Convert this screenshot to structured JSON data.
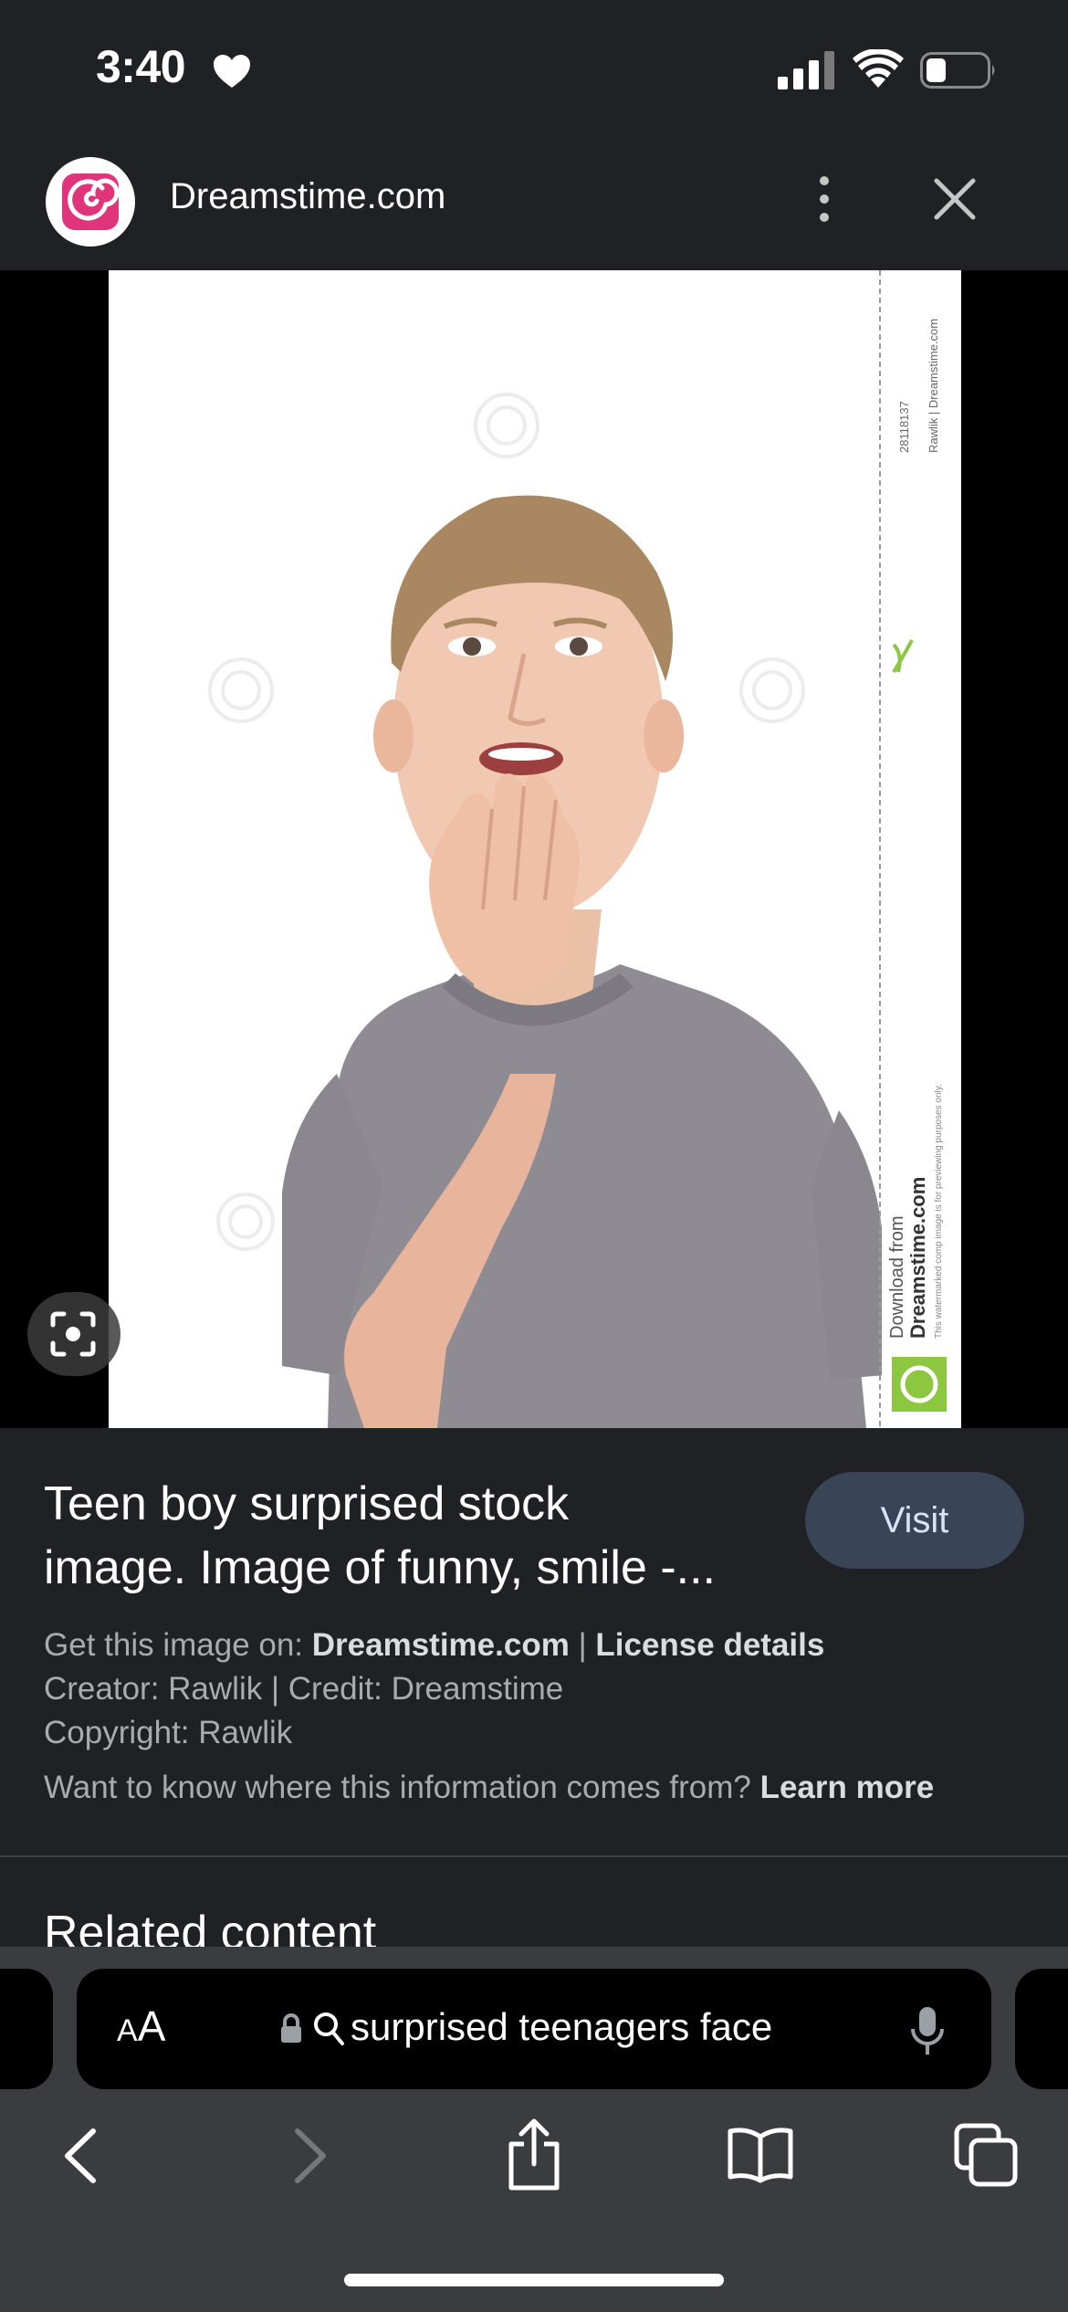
{
  "status_bar": {
    "time": "3:40"
  },
  "header": {
    "site_name": "Dreamstime.com",
    "brand_color": "#e0357a"
  },
  "image": {
    "watermark_id": "28118137",
    "watermark_credit": "Rawlik | Dreamstime.com",
    "watermark_download": "Download from",
    "watermark_brand": "Dreamstime.com",
    "watermark_note": "This watermarked comp image is for previewing purposes only."
  },
  "result": {
    "title_line1": "Teen boy surprised stock",
    "title_line2": "image. Image of funny, smile -...",
    "visit_label": "Visit",
    "get_image_prefix": "Get this image on: ",
    "get_image_site": "Dreamstime.com",
    "separator": " | ",
    "license_label": "License details",
    "creator_credit": "Creator: Rawlik | Credit: Dreamstime",
    "copyright": "Copyright: Rawlik",
    "info_question": "Want to know where this information comes from? ",
    "learn_more": "Learn more"
  },
  "related": {
    "title": "Related content"
  },
  "toolbar": {
    "aa_small": "A",
    "aa_large": "A",
    "url_text": "surprised teenagers face"
  },
  "icons": {
    "status": [
      "heart-icon",
      "signal-icon",
      "wifi-icon",
      "battery-icon"
    ],
    "header": [
      "dreamstime-logo-icon",
      "kebab-menu-icon",
      "close-icon"
    ],
    "image": [
      "google-lens-icon"
    ],
    "toolbar": [
      "lock-icon",
      "search-icon",
      "microphone-icon"
    ],
    "nav": [
      "back-icon",
      "forward-icon",
      "share-icon",
      "bookmarks-icon",
      "tabs-icon"
    ]
  }
}
